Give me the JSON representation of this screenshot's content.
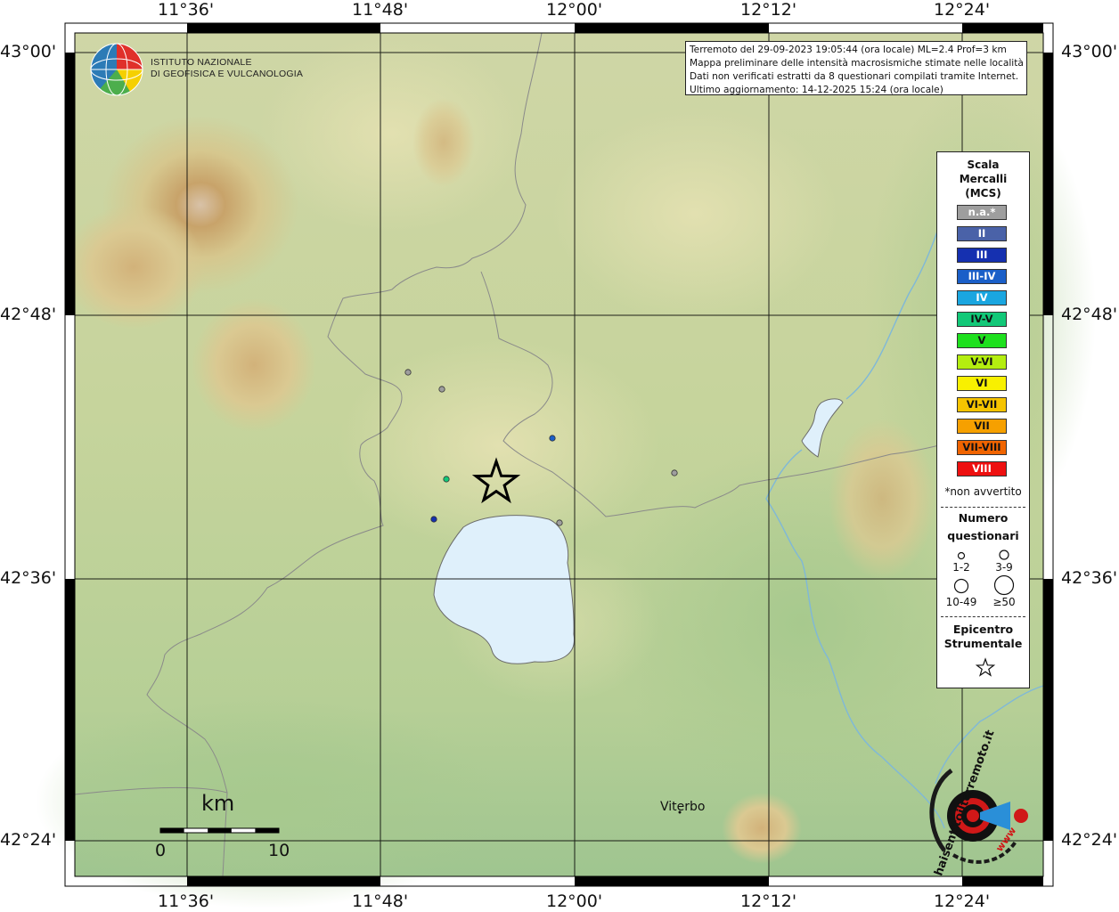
{
  "graticule": {
    "lon_labels": [
      "11°36'",
      "11°48'",
      "12°00'",
      "12°12'",
      "12°24'"
    ],
    "lat_labels": [
      "43°00'",
      "42°48'",
      "42°36'",
      "42°24'"
    ]
  },
  "institute": {
    "line1": "ISTITUTO NAZIONALE",
    "line2": "DI GEOFISICA E VULCANOLOGIA"
  },
  "info": {
    "line1": "Terremoto del 29-09-2023 19:05:44 (ora locale) ML=2.4 Prof=3 km",
    "line2": "Mappa preliminare delle intensità macrosismiche stimate nelle località",
    "line3": "Dati non verificati estratti da 8 questionari compilati tramite Internet.",
    "line4": "Ultimo aggiornamento: 14-12-2025 15:24 (ora locale)"
  },
  "legend": {
    "title_line1": "Scala",
    "title_line2": "Mercalli",
    "title_line3": "(MCS)",
    "classes": [
      {
        "label": "n.a.*",
        "color": "#9e9e9e"
      },
      {
        "label": "II",
        "color": "#4a62a8"
      },
      {
        "label": "III",
        "color": "#1530b0"
      },
      {
        "label": "III-IV",
        "color": "#1a5fc8"
      },
      {
        "label": "IV",
        "color": "#1aa6e0"
      },
      {
        "label": "IV-V",
        "color": "#12c878"
      },
      {
        "label": "V",
        "color": "#1ee01e"
      },
      {
        "label": "V-VI",
        "color": "#b4ee10"
      },
      {
        "label": "VI",
        "color": "#f8f000"
      },
      {
        "label": "VI-VII",
        "color": "#f6c400"
      },
      {
        "label": "VII",
        "color": "#f6a000"
      },
      {
        "label": "VII-VIII",
        "color": "#f06400"
      },
      {
        "label": "VIII",
        "color": "#ee1010"
      }
    ],
    "not_felt_note": "*non avvertito",
    "count_title_line1": "Numero",
    "count_title_line2": "questionari",
    "count_classes": [
      "1-2",
      "3-9",
      "10-49",
      "≥50"
    ],
    "epicenter_title_line1": "Epicentro",
    "epicenter_title_line2": "Strumentale"
  },
  "scale_bar": {
    "unit": "km",
    "min_label": "0",
    "max_label": "10"
  },
  "places": {
    "city": "Viterbo"
  },
  "observations": [
    {
      "intensity": "n.a.*",
      "color": "#9e9e9e"
    },
    {
      "intensity": "n.a.*",
      "color": "#9e9e9e"
    },
    {
      "intensity": "III-IV",
      "color": "#1a5fc8"
    },
    {
      "intensity": "IV-V",
      "color": "#12c878"
    },
    {
      "intensity": "III",
      "color": "#1530b0"
    },
    {
      "intensity": "n.a.*",
      "color": "#9e9e9e"
    },
    {
      "intensity": "n.a.*",
      "color": "#9e9e9e"
    }
  ],
  "colors": {
    "lake": "#dff0fb",
    "river": "#7fb8d8",
    "frame": "#000000"
  },
  "brand": {
    "text": "haisentitoilterremoto.it",
    "url_text": "www"
  }
}
